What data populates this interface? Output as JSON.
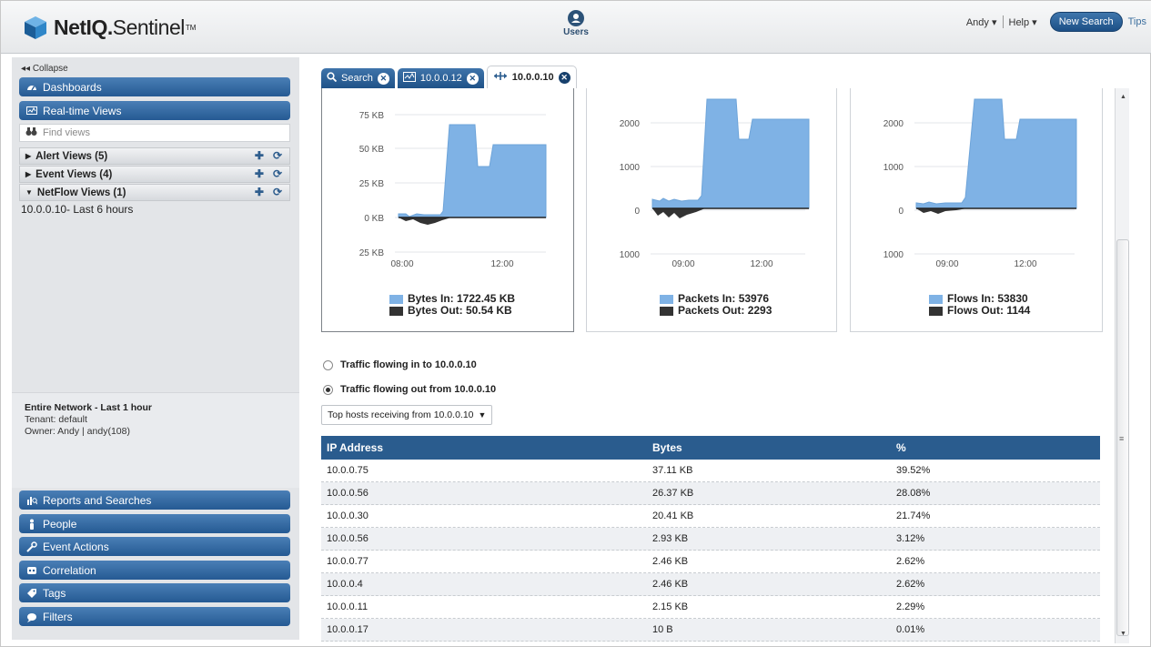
{
  "header": {
    "logo_brand": "NetIQ.",
    "logo_product": "Sentinel",
    "logo_tm": "TM",
    "users_label": "Users",
    "user_menu": "Andy ▾",
    "help_menu": "Help ▾",
    "new_search": "New Search",
    "tips": "Tips"
  },
  "sidebar": {
    "collapse": "◂◂ Collapse",
    "dashboards": "Dashboards",
    "realtime_views": "Real-time Views",
    "find_placeholder": "Find views",
    "alert_views": "Alert Views (5)",
    "event_views": "Event Views (4)",
    "netflow_views": "NetFlow Views (1)",
    "netflow_item": "10.0.0.10- Last 6 hours",
    "network_title": "Entire Network - Last 1 hour",
    "tenant": "Tenant:  default",
    "owner": "Owner:  Andy | andy(108)",
    "bottom_nav": [
      {
        "label": "Reports and Searches",
        "icon": "reports-icon"
      },
      {
        "label": "People",
        "icon": "person-icon"
      },
      {
        "label": "Event Actions",
        "icon": "wrench-icon"
      },
      {
        "label": "Correlation",
        "icon": "correlation-icon"
      },
      {
        "label": "Tags",
        "icon": "tag-icon"
      },
      {
        "label": "Filters",
        "icon": "filter-icon"
      }
    ]
  },
  "tabs": [
    {
      "label": "Search",
      "icon": "search-icon"
    },
    {
      "label": "10.0.0.12",
      "icon": "monitor-icon"
    },
    {
      "label": "10.0.0.10",
      "icon": "netflow-icon"
    }
  ],
  "colors": {
    "accent": "#255a93",
    "in_fill": "#7fb2e5",
    "out_fill": "#333333"
  },
  "chart_data": [
    {
      "type": "area",
      "yticks": [
        "75 KB",
        "50 KB",
        "25 KB",
        "0 KB",
        "25 KB"
      ],
      "xticks": [
        "08:00",
        "12:00"
      ],
      "series": [
        {
          "name": "Bytes In: 1722.45 KB"
        },
        {
          "name": "Bytes Out: 50.54 KB"
        }
      ]
    },
    {
      "type": "area",
      "yticks": [
        "2000",
        "1000",
        "0",
        "1000"
      ],
      "xticks": [
        "09:00",
        "12:00"
      ],
      "series": [
        {
          "name": "Packets In: 53976"
        },
        {
          "name": "Packets Out: 2293"
        }
      ]
    },
    {
      "type": "area",
      "yticks": [
        "2000",
        "1000",
        "0",
        "1000"
      ],
      "xticks": [
        "09:00",
        "12:00"
      ],
      "series": [
        {
          "name": "Flows In: 53830"
        },
        {
          "name": "Flows Out: 1144"
        }
      ]
    }
  ],
  "traffic": {
    "in_label": "Traffic flowing in to 10.0.0.10",
    "out_label": "Traffic flowing out from 10.0.0.10",
    "selected": "out",
    "dropdown": "Top hosts receiving from 10.0.0.10"
  },
  "table": {
    "headers": [
      "IP Address",
      "Bytes",
      "%"
    ],
    "rows": [
      [
        "10.0.0.75",
        "37.11 KB",
        "39.52%"
      ],
      [
        "10.0.0.56",
        "26.37 KB",
        "28.08%"
      ],
      [
        "10.0.0.30",
        "20.41 KB",
        "21.74%"
      ],
      [
        "10.0.0.56",
        "2.93 KB",
        "3.12%"
      ],
      [
        "10.0.0.77",
        "2.46 KB",
        "2.62%"
      ],
      [
        "10.0.0.4",
        "2.46 KB",
        "2.62%"
      ],
      [
        "10.0.0.11",
        "2.15 KB",
        "2.29%"
      ],
      [
        "10.0.0.17",
        "10 B",
        "0.01%"
      ]
    ]
  }
}
